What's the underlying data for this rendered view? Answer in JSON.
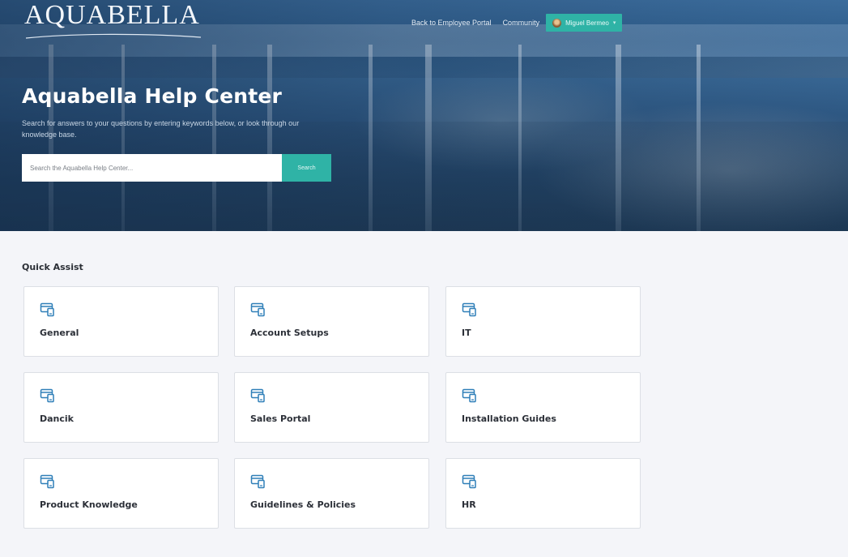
{
  "header": {
    "logo_text": "AQUABELLA",
    "nav": {
      "back_link": "Back to Employee Portal",
      "community_link": "Community",
      "user_name": "Miguel Bermeo",
      "user_caret": "▾"
    }
  },
  "hero": {
    "title": "Aquabella Help Center",
    "subtitle": "Search for answers to your questions by entering keywords below, or look through our knowledge base.",
    "search": {
      "placeholder": "Search the Aquabella Help Center...",
      "button_label": "Search"
    }
  },
  "quick_assist": {
    "title": "Quick Assist",
    "icon": "portal-icon",
    "cards": [
      {
        "label": "General"
      },
      {
        "label": "Account Setups"
      },
      {
        "label": "IT"
      },
      {
        "label": "Dancik"
      },
      {
        "label": "Sales Portal"
      },
      {
        "label": "Installation Guides"
      },
      {
        "label": "Product Knowledge"
      },
      {
        "label": "Guidelines & Policies"
      },
      {
        "label": "HR"
      }
    ]
  },
  "colors": {
    "accent": "#2fb3a6",
    "icon": "#2f7fb8",
    "background": "#f4f5f9"
  }
}
